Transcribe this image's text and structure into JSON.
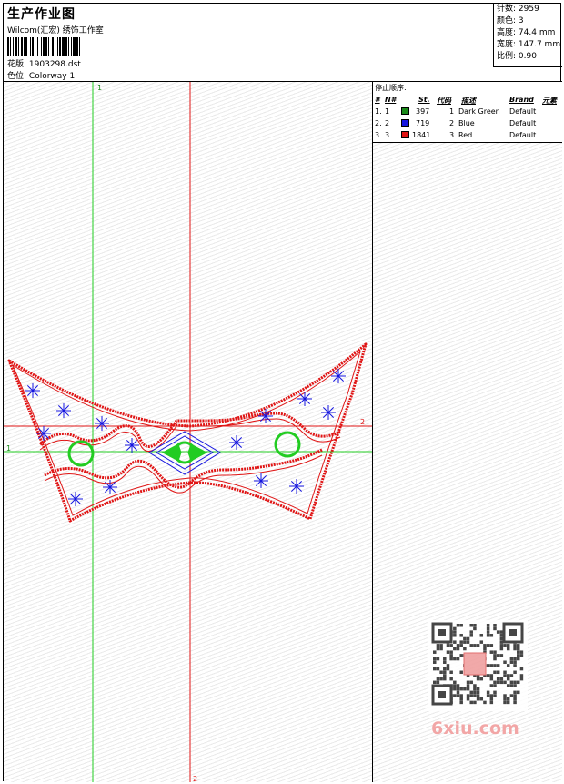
{
  "header": {
    "title": "生产作业图",
    "company": "Wilcom(汇宏) 绣饰工作室",
    "design_label": "花版:",
    "design_file": "1903298.dst",
    "colorway_label": "色位:",
    "colorway": "Colorway 1"
  },
  "stats": [
    {
      "label": "针数:",
      "value": "2959"
    },
    {
      "label": "颜色:",
      "value": "3"
    },
    {
      "label": "高度:",
      "value": "74.4 mm"
    },
    {
      "label": "宽度:",
      "value": "147.7 mm"
    },
    {
      "label": "比例:",
      "value": "0.90"
    }
  ],
  "stop_sequence": {
    "title": "停止顺序:",
    "headers": [
      "#",
      "N#",
      "St.",
      "代码",
      "描述",
      "Brand",
      "元素"
    ],
    "rows": [
      {
        "index": "1.",
        "n": "1",
        "color": "#1a8a1a",
        "stitches": "397",
        "code": "1",
        "desc": "Dark Green",
        "brand": "Default"
      },
      {
        "index": "2.",
        "n": "2",
        "color": "#1515e0",
        "stitches": "719",
        "code": "2",
        "desc": "Blue",
        "brand": "Default"
      },
      {
        "index": "3.",
        "n": "3",
        "color": "#e01515",
        "stitches": "1841",
        "code": "3",
        "desc": "Red",
        "brand": "Default"
      }
    ]
  },
  "guides": {
    "v1": "1",
    "h1": "1",
    "v2": "2",
    "h2": "2"
  },
  "watermark": "6xiu.com",
  "colors": {
    "green": "#22cc22",
    "red": "#e01515",
    "blue": "#1515e0"
  }
}
